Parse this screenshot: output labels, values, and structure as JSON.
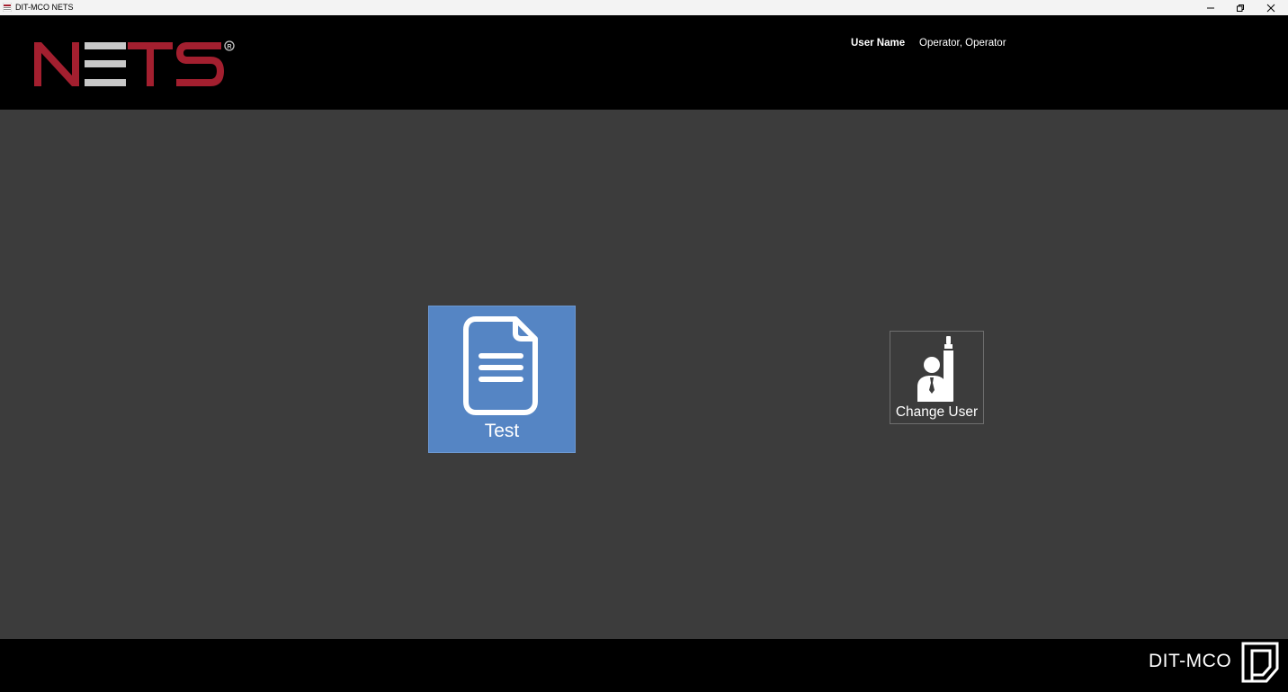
{
  "window": {
    "title": "DIT-MCO NETS",
    "controls": [
      "minimize",
      "restore",
      "close"
    ]
  },
  "header": {
    "logo_text": "NETS",
    "logo_colors": {
      "red": "#a31f2f",
      "gray": "#c8c8c8"
    },
    "user_name_label": "User Name",
    "user_name_value": "Operator, Operator"
  },
  "main": {
    "tiles": [
      {
        "id": "test",
        "label": "Test",
        "icon": "document-icon",
        "color": "#5585c4"
      },
      {
        "id": "change-user",
        "label": "Change User",
        "icon": "user-change-icon"
      }
    ]
  },
  "footer": {
    "brand_text": "DIT-MCO",
    "brand_icon": "dit-mco-logo-mark"
  }
}
